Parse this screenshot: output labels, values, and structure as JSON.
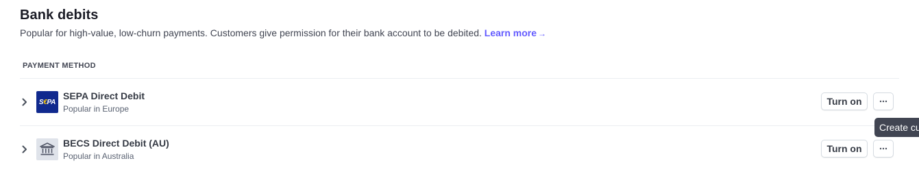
{
  "section": {
    "title": "Bank debits",
    "description": "Popular for high-value, low-churn payments. Customers give permission for their bank account to be debited.",
    "learn_more": "Learn more",
    "learn_more_arrow": "→"
  },
  "table": {
    "column_header": "PAYMENT METHOD",
    "rows": [
      {
        "name": "SEPA Direct Debit",
        "description": "Popular in Europe",
        "logo_text_pre": "S",
        "logo_text_euro": "€",
        "logo_text_post": "PA",
        "logo_icon": "sepa-logo",
        "action_label": "Turn on",
        "more_label": "···"
      },
      {
        "name": "BECS Direct Debit (AU)",
        "description": "Popular in Australia",
        "logo_icon": "bank-building-icon",
        "action_label": "Turn on",
        "more_label": "···"
      }
    ]
  },
  "tooltip": {
    "text": "Create cu"
  },
  "colors": {
    "accent": "#635bff",
    "sepa_blue": "#10298e",
    "sepa_yellow": "#ffcc02",
    "tooltip_bg": "#414552",
    "divider": "#ebeef1"
  }
}
